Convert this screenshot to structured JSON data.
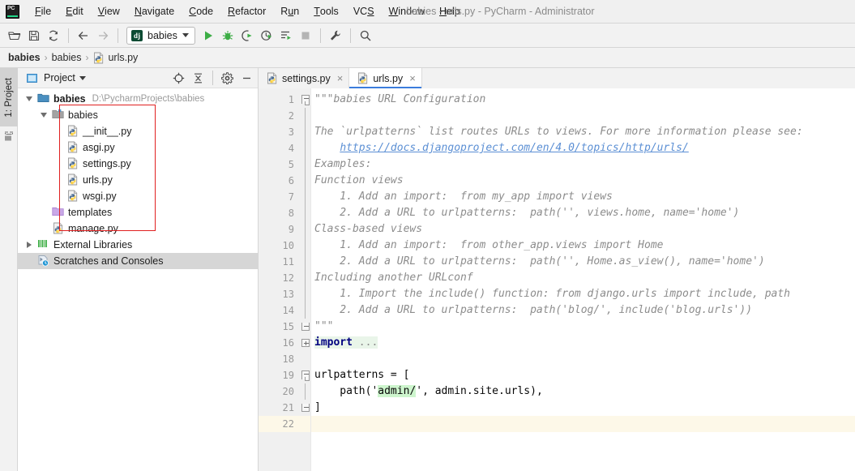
{
  "window": {
    "title": "babies - urls.py - PyCharm - Administrator",
    "logo_text": "PC"
  },
  "menubar": {
    "items": [
      {
        "label": "File",
        "mnemonic": "F"
      },
      {
        "label": "Edit",
        "mnemonic": "E"
      },
      {
        "label": "View",
        "mnemonic": "V"
      },
      {
        "label": "Navigate",
        "mnemonic": "N"
      },
      {
        "label": "Code",
        "mnemonic": "C"
      },
      {
        "label": "Refactor",
        "mnemonic": "R"
      },
      {
        "label": "Run",
        "mnemonic": "u"
      },
      {
        "label": "Tools",
        "mnemonic": "T"
      },
      {
        "label": "VCS",
        "mnemonic": "S"
      },
      {
        "label": "Window",
        "mnemonic": "W"
      },
      {
        "label": "Help",
        "mnemonic": "H"
      }
    ]
  },
  "toolbar": {
    "open_title": "Open",
    "save_title": "Save All",
    "sync_title": "Synchronize",
    "back_title": "Back",
    "forward_title": "Forward",
    "run_config": {
      "label": "babies",
      "icon_text": "dj"
    },
    "run_title": "Run",
    "debug_title": "Debug",
    "run_coverage_title": "Run with Coverage",
    "profile_title": "Profile",
    "more_run_title": "More Run/Debug",
    "stop_title": "Stop",
    "settings_title": "Settings",
    "search_title": "Search Everywhere"
  },
  "breadcrumb": {
    "items": [
      {
        "label": "babies",
        "bold": true,
        "icon": null
      },
      {
        "label": "babies",
        "bold": false,
        "icon": null
      },
      {
        "label": "urls.py",
        "bold": false,
        "icon": "python-file-icon"
      }
    ],
    "separator": "›"
  },
  "left_toolwindow": {
    "tab_label": "1: Project",
    "structure_icon": "structure-icon"
  },
  "project_panel": {
    "title": "Project",
    "view_icon": "project-view-icon",
    "actions": [
      "locate-icon",
      "collapse-all-icon",
      "settings-gear-icon",
      "minimize-icon"
    ],
    "tree": [
      {
        "id": "root",
        "label": "babies",
        "path": "D:\\PycharmProjects\\babies",
        "indent": 0,
        "arrow": "down",
        "icon": "folder-module-icon",
        "bold": true,
        "selected": false
      },
      {
        "id": "pkg",
        "label": "babies",
        "path": "",
        "indent": 1,
        "arrow": "down",
        "icon": "folder-package-icon",
        "bold": false,
        "selected": false
      },
      {
        "id": "init",
        "label": "__init__.py",
        "path": "",
        "indent": 2,
        "arrow": "none",
        "icon": "python-file-icon",
        "bold": false,
        "selected": false
      },
      {
        "id": "asgi",
        "label": "asgi.py",
        "path": "",
        "indent": 2,
        "arrow": "none",
        "icon": "python-file-icon",
        "bold": false,
        "selected": false
      },
      {
        "id": "settings",
        "label": "settings.py",
        "path": "",
        "indent": 2,
        "arrow": "none",
        "icon": "python-file-icon",
        "bold": false,
        "selected": false
      },
      {
        "id": "urls",
        "label": "urls.py",
        "path": "",
        "indent": 2,
        "arrow": "none",
        "icon": "python-file-icon",
        "bold": false,
        "selected": false
      },
      {
        "id": "wsgi",
        "label": "wsgi.py",
        "path": "",
        "indent": 2,
        "arrow": "none",
        "icon": "python-file-icon",
        "bold": false,
        "selected": false
      },
      {
        "id": "templates",
        "label": "templates",
        "path": "",
        "indent": 1,
        "arrow": "none",
        "icon": "folder-templates-icon",
        "bold": false,
        "selected": false
      },
      {
        "id": "manage",
        "label": "manage.py",
        "path": "",
        "indent": 1,
        "arrow": "none",
        "icon": "python-file-icon",
        "bold": false,
        "selected": false
      },
      {
        "id": "extlibs",
        "label": "External Libraries",
        "path": "",
        "indent": 0,
        "arrow": "right",
        "icon": "external-libraries-icon",
        "bold": false,
        "selected": false
      },
      {
        "id": "scratches",
        "label": "Scratches and Consoles",
        "path": "",
        "indent": 0,
        "arrow": "none",
        "icon": "scratches-icon",
        "bold": false,
        "selected": true
      }
    ],
    "annotation": {
      "color": "#e02020",
      "shape": "rectangle"
    }
  },
  "editor": {
    "tabs": [
      {
        "label": "settings.py",
        "icon": "python-file-icon",
        "active": false,
        "close_glyph": "×"
      },
      {
        "label": "urls.py",
        "icon": "python-file-icon",
        "active": true,
        "close_glyph": "×"
      }
    ],
    "active_tab_accent": "#3b7ddd",
    "current_line": 22,
    "lines": [
      {
        "num": "1",
        "fold": "start",
        "segments": [
          {
            "t": "\"\"\"babies URL Configuration",
            "c": "doc"
          }
        ]
      },
      {
        "num": "2",
        "fold": "bar",
        "segments": []
      },
      {
        "num": "3",
        "fold": "bar",
        "segments": [
          {
            "t": "The `urlpatterns` list routes URLs to views. For more information please see:",
            "c": "doc"
          }
        ]
      },
      {
        "num": "4",
        "fold": "bar",
        "segments": [
          {
            "t": "    ",
            "c": "doc"
          },
          {
            "t": "https://docs.djangoproject.com/en/4.0/topics/http/urls/",
            "c": "link"
          }
        ]
      },
      {
        "num": "5",
        "fold": "bar",
        "segments": [
          {
            "t": "Examples:",
            "c": "doc"
          }
        ]
      },
      {
        "num": "6",
        "fold": "bar",
        "segments": [
          {
            "t": "Function views",
            "c": "doc"
          }
        ]
      },
      {
        "num": "7",
        "fold": "bar",
        "segments": [
          {
            "t": "    1. Add an import:  from my_app import views",
            "c": "doc"
          }
        ]
      },
      {
        "num": "8",
        "fold": "bar",
        "segments": [
          {
            "t": "    2. Add a URL to urlpatterns:  path('', views.home, name='home')",
            "c": "doc"
          }
        ]
      },
      {
        "num": "9",
        "fold": "bar",
        "segments": [
          {
            "t": "Class-based views",
            "c": "doc"
          }
        ]
      },
      {
        "num": "10",
        "fold": "bar",
        "segments": [
          {
            "t": "    1. Add an import:  from other_app.views import Home",
            "c": "doc"
          }
        ]
      },
      {
        "num": "11",
        "fold": "bar",
        "segments": [
          {
            "t": "    2. Add a URL to urlpatterns:  path('', Home.as_view(), name='home')",
            "c": "doc"
          }
        ]
      },
      {
        "num": "12",
        "fold": "bar",
        "segments": [
          {
            "t": "Including another URLconf",
            "c": "doc"
          }
        ]
      },
      {
        "num": "13",
        "fold": "bar",
        "segments": [
          {
            "t": "    1. Import the include() function: from django.urls import include, path",
            "c": "doc"
          }
        ]
      },
      {
        "num": "14",
        "fold": "bar",
        "segments": [
          {
            "t": "    2. Add a URL to urlpatterns:  path('blog/', include('blog.urls'))",
            "c": "doc"
          }
        ]
      },
      {
        "num": "15",
        "fold": "end",
        "segments": [
          {
            "t": "\"\"\"",
            "c": "doc"
          }
        ]
      },
      {
        "num": "16",
        "fold": "plus",
        "folded": true,
        "segments": [
          {
            "t": "import",
            "c": "kw"
          },
          {
            "t": " ...",
            "c": "dots"
          }
        ]
      },
      {
        "num": "18",
        "fold": "none",
        "segments": []
      },
      {
        "num": "19",
        "fold": "start",
        "segments": [
          {
            "t": "urlpatterns = [",
            "c": ""
          }
        ]
      },
      {
        "num": "20",
        "fold": "bar",
        "segments": [
          {
            "t": "    path(",
            "c": ""
          },
          {
            "t": "'",
            "c": ""
          },
          {
            "t": "admin/",
            "c": "hl-str"
          },
          {
            "t": "'",
            "c": ""
          },
          {
            "t": ", admin.site.urls),",
            "c": ""
          }
        ]
      },
      {
        "num": "21",
        "fold": "end",
        "segments": [
          {
            "t": "]",
            "c": ""
          }
        ]
      },
      {
        "num": "22",
        "fold": "none",
        "current": true,
        "segments": []
      }
    ]
  }
}
